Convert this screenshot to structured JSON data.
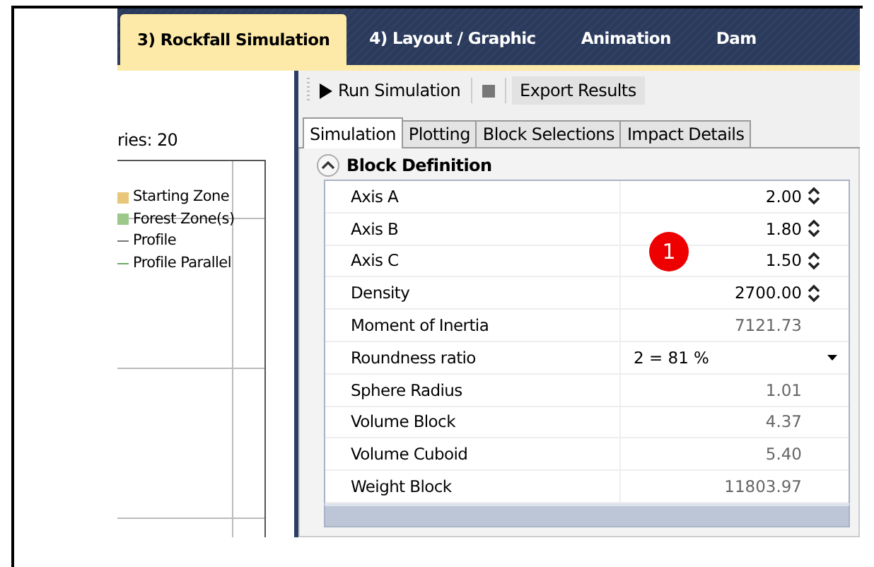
{
  "nav_tabs": [
    {
      "label": "3) Rockfall Simulation",
      "selected": true
    },
    {
      "label": "4) Layout / Graphic",
      "selected": false
    },
    {
      "label": "Animation",
      "selected": false
    },
    {
      "label": "Dam",
      "selected": false
    }
  ],
  "left_panel": {
    "count_text": "ries: 20",
    "legend": [
      {
        "label": "Starting Zone",
        "kind": "area",
        "color": "#e8c77a"
      },
      {
        "label": "Forest Zone(s)",
        "kind": "area",
        "color": "#9cc98a"
      },
      {
        "label": "Profile",
        "kind": "line",
        "color": "#777777"
      },
      {
        "label": "Profile Parallel",
        "kind": "line",
        "color": "#6aa86a"
      }
    ]
  },
  "toolbar": {
    "run_label": "Run Simulation",
    "export_label": "Export Results"
  },
  "tabs": [
    {
      "label": "Simulation",
      "selected": true
    },
    {
      "label": "Plotting",
      "selected": false
    },
    {
      "label": "Block Selections",
      "selected": false
    },
    {
      "label": "Impact Details",
      "selected": false
    }
  ],
  "section": {
    "title": "Block Definition",
    "expanded": true
  },
  "rows": [
    {
      "label": "Axis A",
      "value": "2.00",
      "kind": "spin"
    },
    {
      "label": "Axis B",
      "value": "1.80",
      "kind": "spin"
    },
    {
      "label": "Axis C",
      "value": "1.50",
      "kind": "spin"
    },
    {
      "label": "Density",
      "value": "2700.00",
      "kind": "spin"
    },
    {
      "label": "Moment of Inertia",
      "value": "7121.73",
      "kind": "readonly"
    },
    {
      "label": "Roundness ratio",
      "value": "2 =  81 %",
      "kind": "dropdown"
    },
    {
      "label": "Sphere Radius",
      "value": "1.01",
      "kind": "readonly"
    },
    {
      "label": "Volume Block",
      "value": "4.37",
      "kind": "readonly"
    },
    {
      "label": "Volume Cuboid",
      "value": "5.40",
      "kind": "readonly"
    },
    {
      "label": "Weight Block",
      "value": "11803.97",
      "kind": "readonly"
    }
  ],
  "callout": "1"
}
